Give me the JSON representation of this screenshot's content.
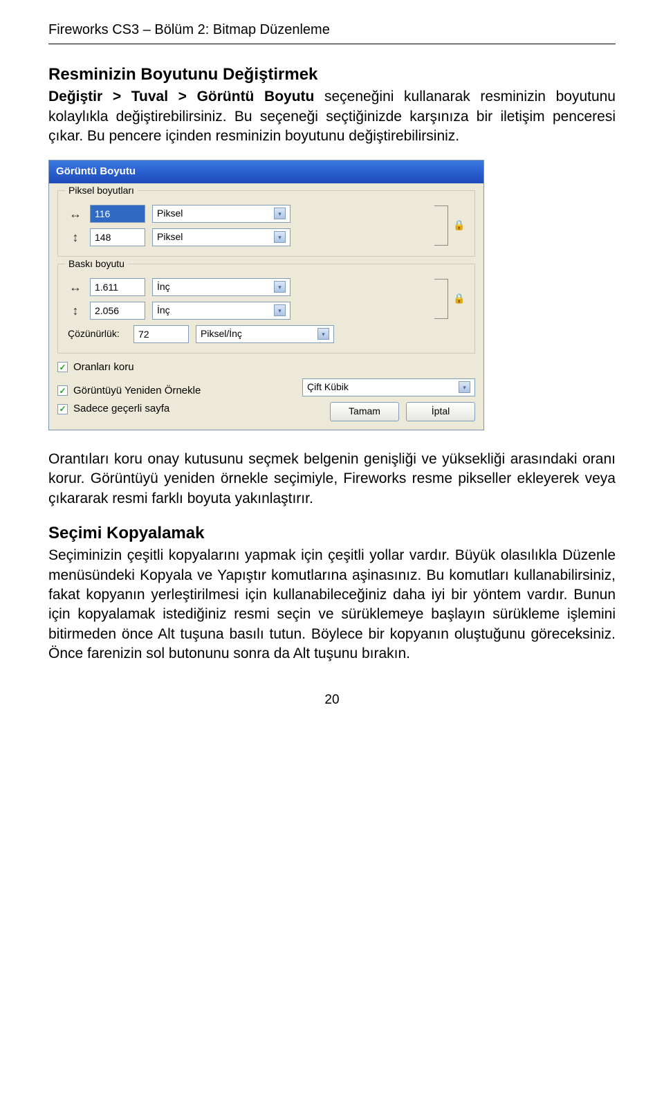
{
  "header": "Fireworks CS3 – Bölüm 2: Bitmap Düzenleme",
  "section1": {
    "title": "Resminizin Boyutunu Değiştirmek",
    "para_before_bold": "",
    "bold_phrase": "Değiştir > Tuval > Görüntü Boyutu",
    "para_after_bold": " seçeneğini kullanarak resminizin boyutunu kolaylıkla değiştirebilirsiniz. Bu seçeneği seçtiğinizde karşınıza bir iletişim penceresi çıkar. Bu pencere içinden resminizin boyutunu değiştirebilirsiniz."
  },
  "dialog": {
    "title": "Görüntü Boyutu",
    "group1": {
      "label": "Piksel boyutları",
      "row1": {
        "icon": "↔",
        "value": "116",
        "unit": "Piksel"
      },
      "row2": {
        "icon": "↕",
        "value": "148",
        "unit": "Piksel"
      },
      "lock": "🔒"
    },
    "group2": {
      "label": "Baskı boyutu",
      "row1": {
        "icon": "↔",
        "value": "1.611",
        "unit": "İnç"
      },
      "row2": {
        "icon": "↕",
        "value": "2.056",
        "unit": "İnç"
      },
      "res_label": "Çözünürlük:",
      "res_value": "72",
      "res_unit": "Piksel/İnç",
      "lock": "🔒"
    },
    "checks": {
      "c1": "Oranları koru",
      "c2": "Görüntüyü Yeniden Örnekle",
      "c2_select": "Çift Kübik",
      "c3": "Sadece geçerli sayfa"
    },
    "buttons": {
      "ok": "Tamam",
      "cancel": "İptal"
    }
  },
  "para2": "Orantıları koru onay kutusunu seçmek belgenin genişliği ve yüksekliği arasındaki oranı korur. Görüntüyü yeniden örnekle seçimiyle, Fireworks resme pikseller ekleyerek veya çıkararak resmi farklı boyuta yakınlaştırır.",
  "section2": {
    "title": "Seçimi Kopyalamak",
    "para": "Seçiminizin çeşitli kopyalarını yapmak için çeşitli yollar vardır. Büyük olasılıkla Düzenle menüsündeki Kopyala ve Yapıştır komutlarına aşinasınız. Bu komutları kullanabilirsiniz, fakat kopyanın yerleştirilmesi için kullanabileceğiniz daha iyi bir yöntem vardır. Bunun için kopyalamak istediğiniz resmi seçin ve sürüklemeye başlayın sürükleme işlemini bitirmeden önce Alt tuşuna basılı tutun. Böylece bir kopyanın oluştuğunu göreceksiniz. Önce farenizin sol butonunu sonra da Alt tuşunu bırakın."
  },
  "page_number": "20"
}
